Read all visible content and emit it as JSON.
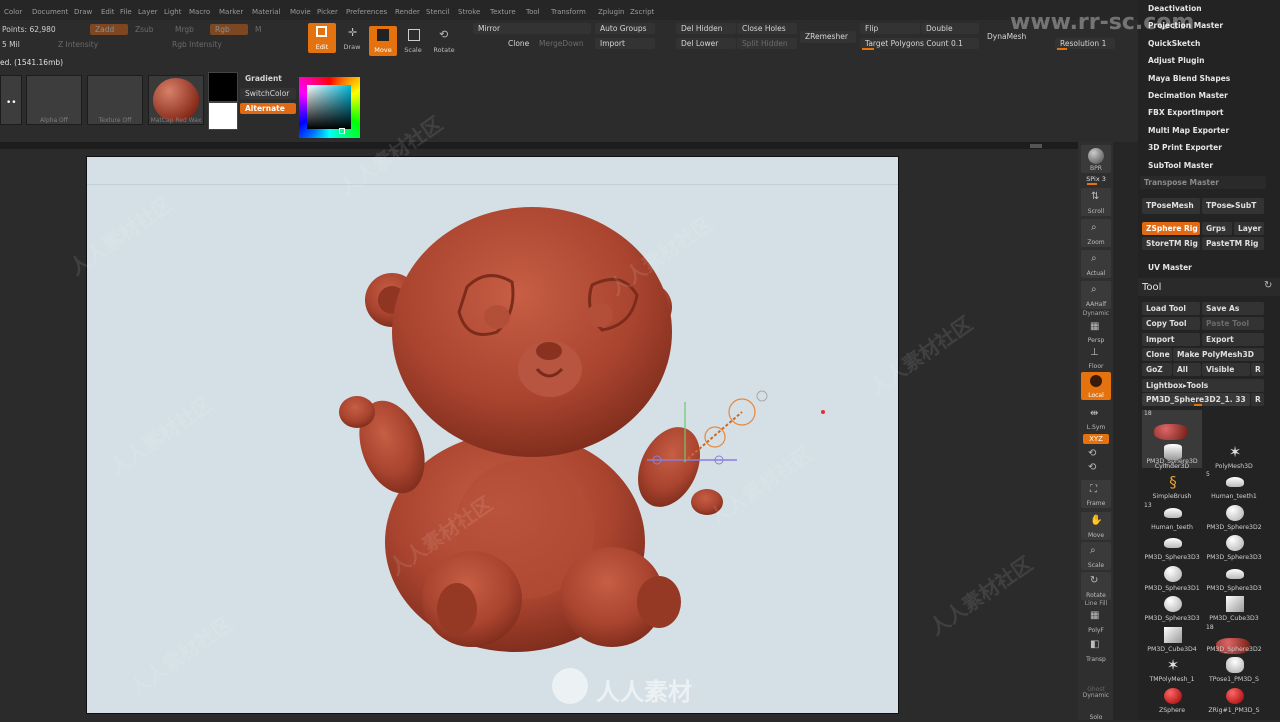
{
  "menubar": [
    "Color",
    "Document",
    "Draw",
    "Edit",
    "File",
    "Layer",
    "Light",
    "Macro",
    "Marker",
    "Material",
    "Movie",
    "Picker",
    "Preferences",
    "Render",
    "Stencil",
    "Stroke",
    "Texture",
    "Tool",
    "Transform",
    "Zplugin",
    "Zscript"
  ],
  "header": {
    "points": "Points: 62,980",
    "mem": "5 Mil",
    "status": "ed. (1541.16mb)",
    "zadd": "Zadd",
    "zsub": "Zsub",
    "zintensity": "Z Intensity",
    "mrgb": "Mrgb",
    "rgb": "Rgb",
    "m": "M",
    "rgb_intensity": "Rgb Intensity",
    "mirror": "Mirror",
    "clone": "Clone",
    "merge_down": "MergeDown",
    "auto_groups": "Auto Groups",
    "import": "Import",
    "del_hidden": "Del Hidden",
    "del_lower": "Del Lower",
    "close_holes": "Close Holes",
    "split_hidden": "Split Hidden",
    "zremesher": "ZRemesher",
    "flip": "Flip",
    "double": "Double",
    "target_polygons": "Target Polygons Count 0.1",
    "dynamesh": "DynaMesh",
    "resolution": "Resolution 1",
    "edit": "Edit",
    "draw": "Draw",
    "move": "Move",
    "scale": "Scale",
    "rotate": "Rotate",
    "gradient": "Gradient",
    "switch_color": "SwitchColor",
    "alternate": "Alternate",
    "alpha_off": "Alpha Off",
    "texture_off": "Texture Off",
    "matcap": "MatCap Red Wax"
  },
  "rightcol": {
    "bpr": "BPR",
    "spix": "SPix 3",
    "scroll": "Scroll",
    "zoom": "Zoom",
    "actual": "Actual",
    "aahalf": "AAHalf",
    "dynamic": "Dynamic",
    "persp": "Persp",
    "floor": "Floor",
    "local": "Local",
    "lsym": "L.Sym",
    "xyz": "XYZ",
    "frame": "Frame",
    "move": "Move",
    "scale": "Scale",
    "rotate": "Rotate",
    "linefill": "Line Fill",
    "polyf": "PolyF",
    "transp": "Transp",
    "ghost": "Ghost",
    "dynamic2": "Dynamic",
    "solo": "Solo"
  },
  "palette": {
    "plugins": [
      "Deactivation",
      "Projection Master",
      "QuickSketch",
      "Adjust Plugin",
      "Maya Blend Shapes",
      "Decimation Master",
      "FBX ExportImport",
      "Multi Map Exporter",
      "3D Print Exporter",
      "SubTool Master"
    ],
    "transpose_master": "Transpose Master",
    "tposemesh": "TPoseMesh",
    "tpose_subt": "TPose▸SubT",
    "zsphere_rig": "ZSphere Rig",
    "grps": "Grps",
    "layer": "Layer",
    "store_tm_rig": "StoreTM Rig",
    "paste_tm_rig": "PasteTM Rig",
    "uv_master": "UV Master",
    "tool_title": "Tool",
    "load_tool": "Load Tool",
    "save_as": "Save As",
    "copy_tool": "Copy Tool",
    "paste_tool": "Paste Tool",
    "import": "Import",
    "export": "Export",
    "clone": "Clone",
    "make_polymesh": "Make PolyMesh3D",
    "goz": "GoZ",
    "all": "All",
    "visible": "Visible",
    "r": "R",
    "lightbox_tools": "Lightbox▸Tools",
    "current_tool": "PM3D_Sphere3D2_1. 33",
    "r2": "R",
    "tools": [
      {
        "name": "PM3D_Sphere3D",
        "num": "18"
      },
      {
        "name": "Cylinder3D",
        "num": ""
      },
      {
        "name": "PolyMesh3D",
        "num": ""
      },
      {
        "name": "SimpleBrush",
        "num": ""
      },
      {
        "name": "Human_teeth1",
        "num": "5"
      },
      {
        "name": "Human_teeth",
        "num": "13"
      },
      {
        "name": "PM3D_Sphere3D2",
        "num": ""
      },
      {
        "name": "PM3D_Sphere3D3",
        "num": ""
      },
      {
        "name": "PM3D_Sphere3D3",
        "num": ""
      },
      {
        "name": "PM3D_Sphere3D1",
        "num": ""
      },
      {
        "name": "PM3D_Sphere3D3",
        "num": ""
      },
      {
        "name": "PM3D_Sphere3D3",
        "num": ""
      },
      {
        "name": "PM3D_Cube3D3",
        "num": ""
      },
      {
        "name": "PM3D_Cube3D4",
        "num": ""
      },
      {
        "name": "PM3D_Sphere3D2",
        "num": "18"
      },
      {
        "name": "TMPolyMesh_1",
        "num": ""
      },
      {
        "name": "TPose1_PM3D_S",
        "num": ""
      },
      {
        "name": "ZSphere",
        "num": ""
      },
      {
        "name": "ZRig#1_PM3D_S",
        "num": ""
      }
    ]
  },
  "watermark": {
    "site": "www.rr-sc.com",
    "logo_text": "人人素材",
    "repeat": "人人素材社区"
  },
  "colors": {
    "accent": "#e4730f",
    "canvas": "#d4e0e6",
    "model": "#a9442f"
  }
}
